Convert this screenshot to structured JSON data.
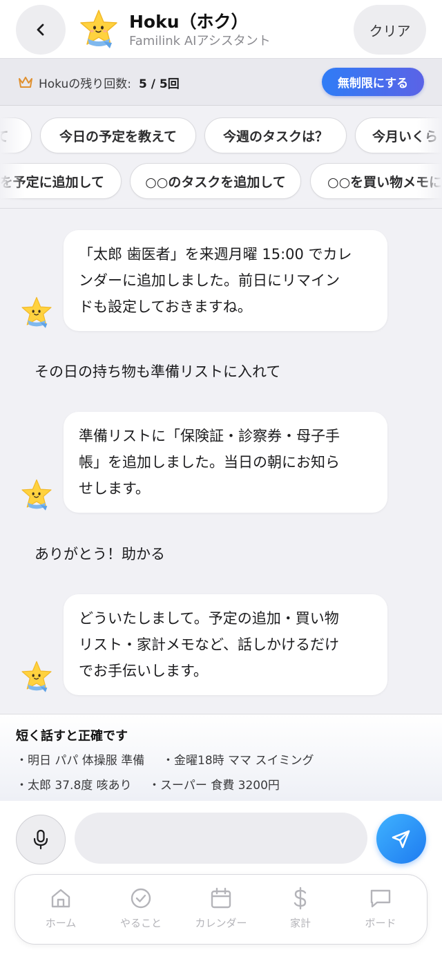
{
  "header": {
    "title": "Hoku（ホク）",
    "subtitle": "Familink AIアシスタント",
    "clear_label": "クリア"
  },
  "quota": {
    "label": "Hokuの残り回数:",
    "value": "5 / 5回",
    "upgrade_label": "無制限にする"
  },
  "suggestions": {
    "row1": [
      "て",
      "今日の予定を教えて",
      "今週のタスクは？",
      "今月いくら"
    ],
    "row2": [
      "を予定に追加して",
      "○○のタスクを追加して",
      "○○を買い物メモに"
    ]
  },
  "messages": [
    {
      "role": "assistant",
      "lines": [
        "「太郎 歯医者」を来週月曜 15:00 でカレ",
        "ンダーに追加しました。前日にリマイン",
        "ドも設定しておきますね。"
      ]
    },
    {
      "role": "user",
      "text": "その日の持ち物も準備リストに入れて"
    },
    {
      "role": "assistant",
      "lines": [
        "準備リストに「保険証・診察券・母子手",
        "帳」を追加しました。当日の朝にお知ら",
        "せします。"
      ]
    },
    {
      "role": "user",
      "text": "ありがとう！助かる"
    },
    {
      "role": "assistant",
      "lines": [
        "どういたしまして。予定の追加・買い物",
        "リスト・家計メモなど、話しかけるだけ",
        "でお手伝いします。"
      ]
    }
  ],
  "tips": {
    "title": "短く話すと正確です",
    "items": [
      "・明日 パパ 体操服 準備",
      "・金曜18時 ママ スイミング",
      "・太郎 37.8度 咳あり",
      "・スーパー 食費 3200円"
    ]
  },
  "input": {
    "value": "",
    "placeholder": ""
  },
  "nav": {
    "items": [
      {
        "label": "ホーム",
        "icon": "home-icon"
      },
      {
        "label": "やること",
        "icon": "check-circle-icon"
      },
      {
        "label": "カレンダー",
        "icon": "calendar-icon"
      },
      {
        "label": "家計",
        "icon": "dollar-icon"
      },
      {
        "label": "ボード",
        "icon": "message-square-icon"
      }
    ]
  },
  "colors": {
    "accent_gradient_start": "#2f7cf6",
    "accent_gradient_end": "#5b63e6",
    "send_button": "#1e7bf0",
    "crown": "#e0902f",
    "nav_inactive": "#b4b4b9",
    "mascot_star": "#ffd23f",
    "mascot_scarf": "#7fb8ee"
  }
}
